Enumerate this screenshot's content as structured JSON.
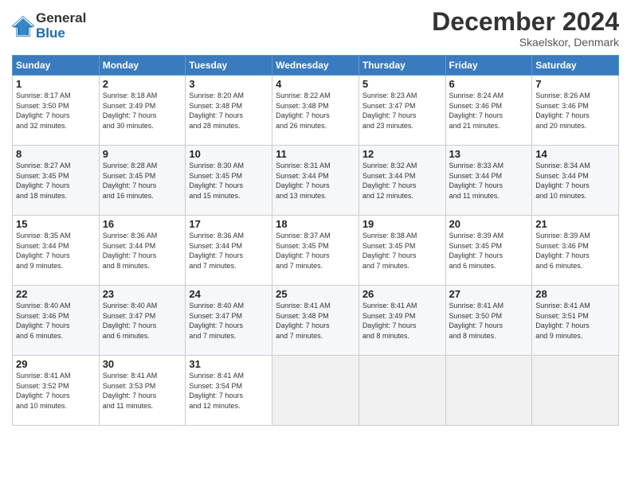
{
  "header": {
    "logo_general": "General",
    "logo_blue": "Blue",
    "title": "December 2024",
    "location": "Skaelskor, Denmark"
  },
  "days_of_week": [
    "Sunday",
    "Monday",
    "Tuesday",
    "Wednesday",
    "Thursday",
    "Friday",
    "Saturday"
  ],
  "weeks": [
    [
      {
        "day": "1",
        "sunrise": "8:17 AM",
        "sunset": "3:50 PM",
        "daylight": "7 hours and 32 minutes."
      },
      {
        "day": "2",
        "sunrise": "8:18 AM",
        "sunset": "3:49 PM",
        "daylight": "7 hours and 30 minutes."
      },
      {
        "day": "3",
        "sunrise": "8:20 AM",
        "sunset": "3:48 PM",
        "daylight": "7 hours and 28 minutes."
      },
      {
        "day": "4",
        "sunrise": "8:22 AM",
        "sunset": "3:48 PM",
        "daylight": "7 hours and 26 minutes."
      },
      {
        "day": "5",
        "sunrise": "8:23 AM",
        "sunset": "3:47 PM",
        "daylight": "7 hours and 23 minutes."
      },
      {
        "day": "6",
        "sunrise": "8:24 AM",
        "sunset": "3:46 PM",
        "daylight": "7 hours and 21 minutes."
      },
      {
        "day": "7",
        "sunrise": "8:26 AM",
        "sunset": "3:46 PM",
        "daylight": "7 hours and 20 minutes."
      }
    ],
    [
      {
        "day": "8",
        "sunrise": "8:27 AM",
        "sunset": "3:45 PM",
        "daylight": "7 hours and 18 minutes."
      },
      {
        "day": "9",
        "sunrise": "8:28 AM",
        "sunset": "3:45 PM",
        "daylight": "7 hours and 16 minutes."
      },
      {
        "day": "10",
        "sunrise": "8:30 AM",
        "sunset": "3:45 PM",
        "daylight": "7 hours and 15 minutes."
      },
      {
        "day": "11",
        "sunrise": "8:31 AM",
        "sunset": "3:44 PM",
        "daylight": "7 hours and 13 minutes."
      },
      {
        "day": "12",
        "sunrise": "8:32 AM",
        "sunset": "3:44 PM",
        "daylight": "7 hours and 12 minutes."
      },
      {
        "day": "13",
        "sunrise": "8:33 AM",
        "sunset": "3:44 PM",
        "daylight": "7 hours and 11 minutes."
      },
      {
        "day": "14",
        "sunrise": "8:34 AM",
        "sunset": "3:44 PM",
        "daylight": "7 hours and 10 minutes."
      }
    ],
    [
      {
        "day": "15",
        "sunrise": "8:35 AM",
        "sunset": "3:44 PM",
        "daylight": "7 hours and 9 minutes."
      },
      {
        "day": "16",
        "sunrise": "8:36 AM",
        "sunset": "3:44 PM",
        "daylight": "7 hours and 8 minutes."
      },
      {
        "day": "17",
        "sunrise": "8:36 AM",
        "sunset": "3:44 PM",
        "daylight": "7 hours and 7 minutes."
      },
      {
        "day": "18",
        "sunrise": "8:37 AM",
        "sunset": "3:45 PM",
        "daylight": "7 hours and 7 minutes."
      },
      {
        "day": "19",
        "sunrise": "8:38 AM",
        "sunset": "3:45 PM",
        "daylight": "7 hours and 7 minutes."
      },
      {
        "day": "20",
        "sunrise": "8:39 AM",
        "sunset": "3:45 PM",
        "daylight": "7 hours and 6 minutes."
      },
      {
        "day": "21",
        "sunrise": "8:39 AM",
        "sunset": "3:46 PM",
        "daylight": "7 hours and 6 minutes."
      }
    ],
    [
      {
        "day": "22",
        "sunrise": "8:40 AM",
        "sunset": "3:46 PM",
        "daylight": "7 hours and 6 minutes."
      },
      {
        "day": "23",
        "sunrise": "8:40 AM",
        "sunset": "3:47 PM",
        "daylight": "7 hours and 6 minutes."
      },
      {
        "day": "24",
        "sunrise": "8:40 AM",
        "sunset": "3:47 PM",
        "daylight": "7 hours and 7 minutes."
      },
      {
        "day": "25",
        "sunrise": "8:41 AM",
        "sunset": "3:48 PM",
        "daylight": "7 hours and 7 minutes."
      },
      {
        "day": "26",
        "sunrise": "8:41 AM",
        "sunset": "3:49 PM",
        "daylight": "7 hours and 8 minutes."
      },
      {
        "day": "27",
        "sunrise": "8:41 AM",
        "sunset": "3:50 PM",
        "daylight": "7 hours and 8 minutes."
      },
      {
        "day": "28",
        "sunrise": "8:41 AM",
        "sunset": "3:51 PM",
        "daylight": "7 hours and 9 minutes."
      }
    ],
    [
      {
        "day": "29",
        "sunrise": "8:41 AM",
        "sunset": "3:52 PM",
        "daylight": "7 hours and 10 minutes."
      },
      {
        "day": "30",
        "sunrise": "8:41 AM",
        "sunset": "3:53 PM",
        "daylight": "7 hours and 11 minutes."
      },
      {
        "day": "31",
        "sunrise": "8:41 AM",
        "sunset": "3:54 PM",
        "daylight": "7 hours and 12 minutes."
      },
      null,
      null,
      null,
      null
    ]
  ],
  "labels": {
    "sunrise": "Sunrise:",
    "sunset": "Sunset:",
    "daylight": "Daylight hours"
  }
}
